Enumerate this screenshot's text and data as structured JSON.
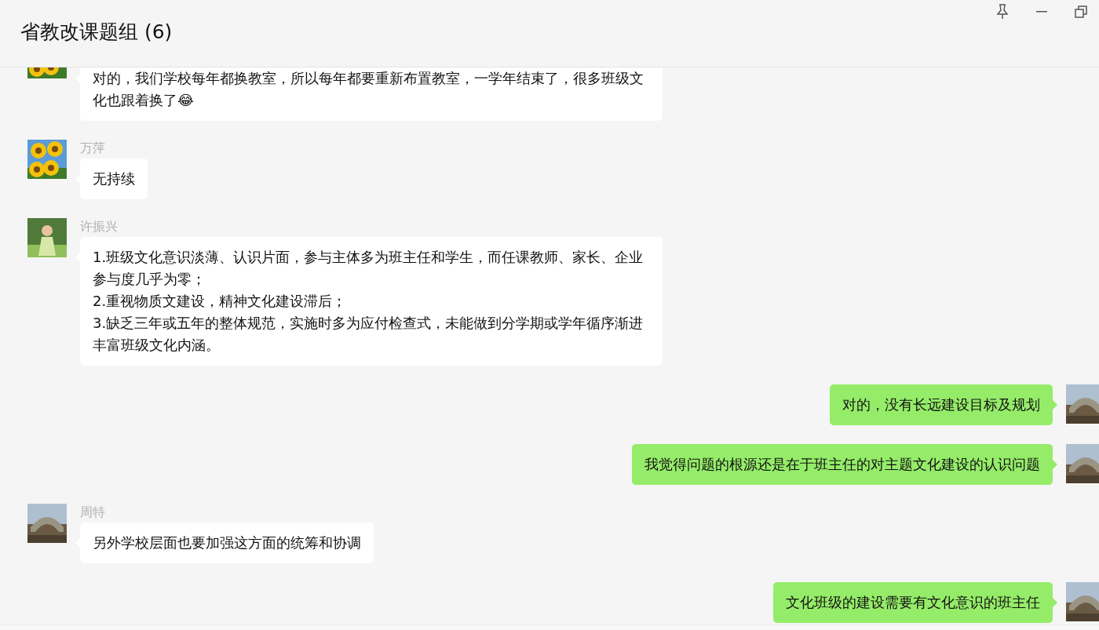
{
  "window": {
    "title": "省教改课题组 (6)"
  },
  "messages": [
    {
      "kind": "received",
      "text": "对的，我们学校每年都换教室，所以每年都要重新布置教室，一学年结束了，很多班级文化也跟着换了😂"
    },
    {
      "kind": "received",
      "sender": "万萍",
      "text": "无持续"
    },
    {
      "kind": "received",
      "sender": "许振兴",
      "text": "1.班级文化意识淡薄、认识片面，参与主体多为班主任和学生，而任课教师、家长、企业参与度几乎为零；\n2.重视物质文建设，精神文化建设滞后；\n3.缺乏三年或五年的整体规范，实施时多为应付检查式，未能做到分学期或学年循序渐进丰富班级文化内涵。"
    },
    {
      "kind": "sent",
      "text": "对的，没有长远建设目标及规划"
    },
    {
      "kind": "sent",
      "text": "我觉得问题的根源还是在于班主任的对主题文化建设的认识问题"
    },
    {
      "kind": "received",
      "sender": "周特",
      "text": "另外学校层面也要加强这方面的统筹和协调"
    },
    {
      "kind": "sent",
      "text": "文化班级的建设需要有文化意识的班主任"
    }
  ]
}
